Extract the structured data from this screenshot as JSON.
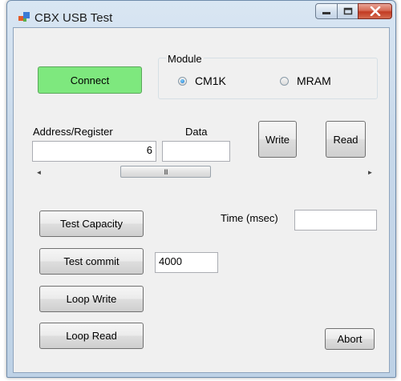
{
  "window": {
    "title": "CBX USB Test",
    "controls": {
      "minimize": "minimize-icon",
      "maximize": "maximize-icon",
      "close": "close-icon"
    }
  },
  "connect": {
    "label": "Connect",
    "color": "#7ee87e"
  },
  "module": {
    "label": "Module",
    "options": [
      {
        "label": "CM1K",
        "selected": true
      },
      {
        "label": "MRAM",
        "selected": false
      }
    ]
  },
  "address": {
    "label": "Address/Register",
    "value": "6"
  },
  "data_field": {
    "label": "Data",
    "value": ""
  },
  "write_button": "Write",
  "read_button": "Read",
  "scrollbar": {
    "left_arrow": "◄",
    "right_arrow": "►",
    "grip": "III"
  },
  "test_capacity_button": "Test Capacity",
  "time": {
    "label": "Time (msec)",
    "value": ""
  },
  "test_commit_button": "Test commit",
  "commit_value": "4000",
  "loop_write_button": "Loop Write",
  "loop_read_button": "Loop Read",
  "abort_button": "Abort"
}
